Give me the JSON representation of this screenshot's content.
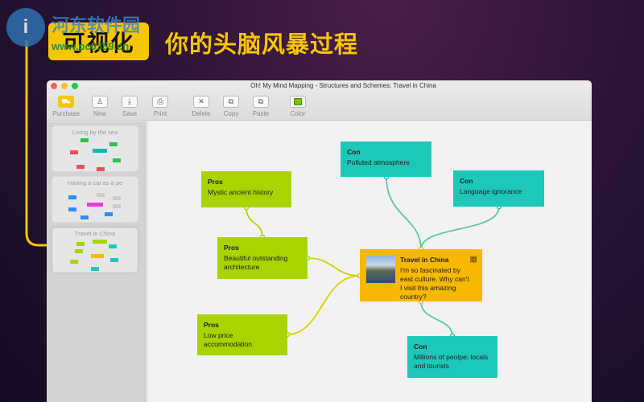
{
  "promo": {
    "badge": "可视化",
    "headline": "你的头脑风暴过程"
  },
  "watermark": {
    "logo": "i",
    "name": "河东软件园",
    "url": "www.pc0359.cn"
  },
  "window": {
    "title": "Oh! My Mind Mapping - Structures and Schemes: Travel in China"
  },
  "toolbar": [
    {
      "label": "Purchase",
      "icon": "cart-icon"
    },
    {
      "label": "New",
      "icon": "hierarchy-icon"
    },
    {
      "label": "Save",
      "icon": "download-icon"
    },
    {
      "label": "Print",
      "icon": "printer-icon"
    },
    {
      "label": "Delete",
      "icon": "x-icon"
    },
    {
      "label": "Copy",
      "icon": "copy-icon"
    },
    {
      "label": "Paste",
      "icon": "paste-icon"
    },
    {
      "label": "Color",
      "icon": "color-swatch-icon"
    }
  ],
  "sidebar": {
    "maps": [
      {
        "title": "Living by the sea"
      },
      {
        "title": "Having a cat as a pe"
      },
      {
        "title": "Travel in China"
      }
    ]
  },
  "nodes": {
    "center": {
      "title": "Travel in China",
      "text": "I'm so fascinated by east culture. Why can't I visit this amazing country?"
    },
    "pros1": {
      "title": "Pros",
      "text": "Mystic ancient history"
    },
    "pros2": {
      "title": "Pros",
      "text": "Beautiful outstanding architecture"
    },
    "pros3": {
      "title": "Pros",
      "text": "Low price accommodation"
    },
    "con1": {
      "title": "Con",
      "text": "Polluted atmosphere"
    },
    "con2": {
      "title": "Con",
      "text": "Language ignorance"
    },
    "con3": {
      "title": "Con",
      "text": "Millions of peolpe: locals and tourists"
    }
  },
  "colors": {
    "pros": "#a9d400",
    "con": "#1ec8b9",
    "center": "#f6b900",
    "accent": "#f7c600"
  }
}
